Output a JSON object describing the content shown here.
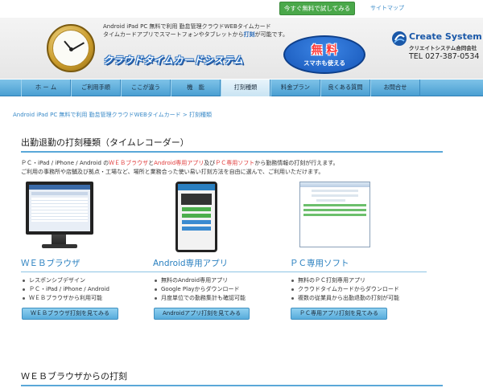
{
  "topbar": {
    "try_label": "今すぐ無料で試してみる",
    "sitemap_label": "サイトマップ"
  },
  "header": {
    "desc_line1": "Android iPad PC 無料で利用 勤怠管理クラウドWEBタイムカード",
    "desc_line2_a": "タイムカードアプリでスマートフォンやタブレットから",
    "desc_line2_b": "打刻",
    "desc_line2_c": "が可能です。",
    "logo_text": "クラウドタイムカードシステム",
    "free_big": "無 料",
    "free_small": "スマホも使える",
    "company_name": "Create System",
    "company_jp": "クリエイトシステム合同会社",
    "company_tel": "TEL 027-387-0534"
  },
  "nav": {
    "items": [
      {
        "label": "ホ ー ム"
      },
      {
        "label": "ご利用手順"
      },
      {
        "label": "ここが違う"
      },
      {
        "label": "機　能"
      },
      {
        "label": "打刻種類"
      },
      {
        "label": "料金プラン"
      },
      {
        "label": "良くある質問"
      },
      {
        "label": "お問合せ"
      }
    ],
    "active_index": 4
  },
  "breadcrumb": {
    "home": "Android iPad PC 無料で利用 勤怠管理クラウドWEBタイムカード",
    "separator": " > ",
    "current": "打刻種類"
  },
  "main": {
    "title": "出勤退勤の打刻種類（タイムレコーダー）",
    "intro_a": "ＰＣ・iPad / iPhone / Android の",
    "intro_web": "ＷＥＢブラウザ",
    "intro_b": "と",
    "intro_app": "Android専用アプリ",
    "intro_c": "及び",
    "intro_pc": "ＰＣ専用ソフト",
    "intro_d": "から勤務情報の打刻が行えます。",
    "intro_line2": "ご利用の事務所や店舗及び拠点・工場など、場所と業務合った使い易い打刻方法を自由に選んで、ご利用いただけます。",
    "columns": [
      {
        "title": "ＷＥＢブラウザ",
        "items": [
          "レスポンシブデザイン",
          "ＰＣ・iPad / iPhone / Android",
          "ＷＥＢブラウザから利用可能"
        ],
        "button": "ＷＥＢブラウザ打刻を見てみる"
      },
      {
        "title": "Android専用アプリ",
        "items": [
          "無料のAndroid専用アプリ",
          "Google Playからダウンロード",
          "月度単位での勤務集計も確認可能"
        ],
        "button": "Androidアプリ打刻を見てみる"
      },
      {
        "title": "ＰＣ専用ソフト",
        "items": [
          "無料のＰＣ打刻専用アプリ",
          "クラウドタイムカードからダウンロード",
          "複数の従業員から出勤退勤の打刻が可能"
        ],
        "button": "ＰＣ専用アプリ打刻を見てみる"
      }
    ],
    "bottom_title": "ＷＥＢブラウザからの打刻"
  }
}
